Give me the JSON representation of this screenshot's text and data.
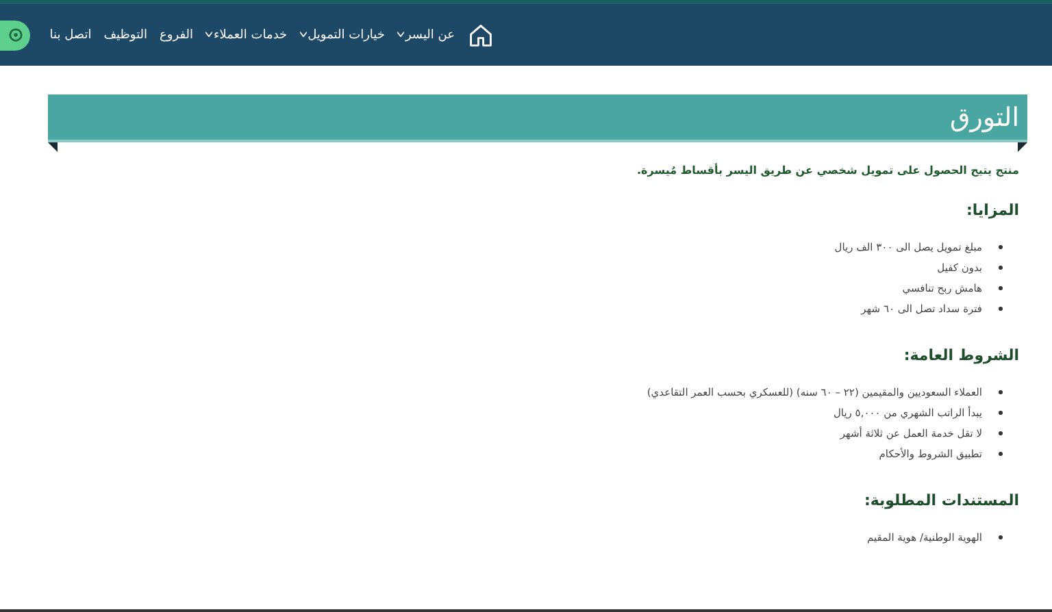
{
  "nav": {
    "items": [
      {
        "label": "عن اليسر",
        "dropdown": true
      },
      {
        "label": "خيارات التمويل",
        "dropdown": true
      },
      {
        "label": "خدمات العملاء",
        "dropdown": true
      },
      {
        "label": "الفروع",
        "dropdown": false
      },
      {
        "label": "التوظيف",
        "dropdown": false
      },
      {
        "label": "اتصل بنا",
        "dropdown": false
      }
    ]
  },
  "banner": {
    "title": "التورق"
  },
  "intro": "منتج يتيح الحصول على تمويل شخصي عن طريق اليسر بأقساط مُيسرة.",
  "sections": [
    {
      "heading": "المزايا:",
      "items": [
        "مبلغ تمويل يصل الى ٣٠٠ الف ريال",
        "بدون كفيل",
        "هامش ربح تنافسي",
        "فترة سداد تصل الى ٦٠ شهر"
      ]
    },
    {
      "heading": "الشروط العامة:",
      "items": [
        "العملاء السعوديين والمقيمين (٢٢ – ٦٠ سنه) (للعسكري بحسب العمر التقاعدي)",
        "يبدأ الراتب الشهري من ٥,٠٠٠ ريال",
        "لا تقل خدمة العمل عن ثلاثة أشهر",
        "تطبيق الشروط والأحكام"
      ]
    },
    {
      "heading": "المستندات المطلوبة:",
      "items": [
        "الهوية الوطنية/ هوية المقيم"
      ]
    }
  ]
}
